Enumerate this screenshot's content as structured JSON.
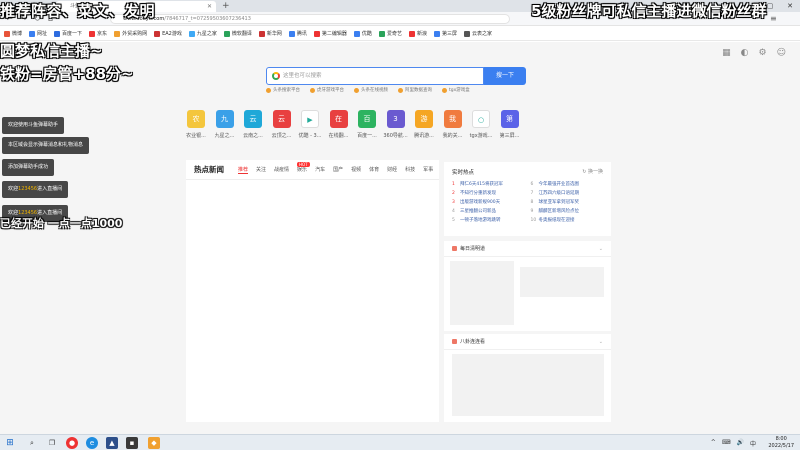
{
  "browser": {
    "tab_title": "斗鱼直播",
    "url_host": "www.douyu.com",
    "url_rest": "/7846717_t=0725950360723641​3",
    "window_controls": [
      "—",
      "▢",
      "✕"
    ],
    "new_tab": "+"
  },
  "bookmarks": [
    {
      "label": "微博",
      "color": "#e8543a"
    },
    {
      "label": "网址",
      "color": "#3b7ff0"
    },
    {
      "label": "百度一下",
      "color": "#2d6cdf"
    },
    {
      "label": "京东",
      "color": "#e33"
    },
    {
      "label": "外贸采购网",
      "color": "#f0a030"
    },
    {
      "label": "EA2游戏",
      "color": "#c33"
    },
    {
      "label": "九星之家",
      "color": "#3fa9f5"
    },
    {
      "label": "微软翻译",
      "color": "#2aa35a"
    },
    {
      "label": "新华网",
      "color": "#c33"
    },
    {
      "label": "腾讯",
      "color": "#3b7ff0"
    },
    {
      "label": "第二编辑器",
      "color": "#e33"
    },
    {
      "label": "优酷",
      "color": "#3b7ff0"
    },
    {
      "label": "爱奇艺",
      "color": "#2aa35a"
    },
    {
      "label": "新浪",
      "color": "#e33"
    },
    {
      "label": "第三屏",
      "color": "#3b7ff0"
    },
    {
      "label": "云表之家",
      "color": "#555"
    }
  ],
  "search": {
    "placeholder": "这里也可以搜索",
    "button_label": "搜一下"
  },
  "quick_links": [
    "头条搜索平台",
    "虎牙游戏平台",
    "头条在线视频",
    "阿里数据查询",
    "tgx游戏盒"
  ],
  "apps": [
    {
      "label": "农业银...",
      "glyph": "农",
      "color": "#f4c63d"
    },
    {
      "label": "九星之...",
      "glyph": "九",
      "color": "#3aa0e8"
    },
    {
      "label": "云南之...",
      "glyph": "云",
      "color": "#1fa8d8"
    },
    {
      "label": "云顶之...",
      "glyph": "云",
      "color": "#e84040"
    },
    {
      "label": "优酷 - 3...",
      "glyph": "▶",
      "color": "#ffffff"
    },
    {
      "label": "在线翻...",
      "glyph": "在",
      "color": "#e84040"
    },
    {
      "label": "百度一...",
      "glyph": "百",
      "color": "#2db360"
    },
    {
      "label": "360导航...",
      "glyph": "3",
      "color": "#6a5ad0"
    },
    {
      "label": "腾讯游...",
      "glyph": "游",
      "color": "#f5a623"
    },
    {
      "label": "我的关...",
      "glyph": "我",
      "color": "#f07b3f"
    },
    {
      "label": "tgx游戏...",
      "glyph": "○",
      "color": "#ffffff"
    },
    {
      "label": "第三屏...",
      "glyph": "第",
      "color": "#5b63e8"
    }
  ],
  "news": {
    "title": "热点新闻",
    "tabs": [
      "推荐",
      "关注",
      "战疫情",
      "娱乐",
      "汽车",
      "国产",
      "视频",
      "体育",
      "财经",
      "科技",
      "军事"
    ],
    "hot_badge": "HOT"
  },
  "hot_search": {
    "title": "实时热点",
    "refresh": "换一换",
    "items": [
      {
        "num": "1",
        "text": "拜仁6天415将获冠军"
      },
      {
        "num": "6",
        "text": "今年最强开业首选图"
      },
      {
        "num": "2",
        "text": "不知行分重新发现"
      },
      {
        "num": "7",
        "text": "江苏四六级口语延期"
      },
      {
        "num": "3",
        "text": "出版游戏新规900天"
      },
      {
        "num": "8",
        "text": "球星亚军拿到冠军奖"
      },
      {
        "num": "4",
        "text": "三星推翻公司新品"
      },
      {
        "num": "9",
        "text": "麒麟区新增风险点位"
      },
      {
        "num": "5",
        "text": "一顿子落地游戏跳转"
      },
      {
        "num": "10",
        "text": "冬奥报纸现在迎接"
      }
    ]
  },
  "cards": {
    "daily": "每日清明道",
    "novel": "八卦连连看"
  },
  "overlay": {
    "top_left": "推荐阵容、菜文、发明",
    "top_right": "5级粉丝牌可私信主播进微信粉丝群",
    "line1": "圆梦私信主播~",
    "line2": "铁粉=房管+88分~",
    "bottom_left": "已经开始 一点一点1000"
  },
  "chat": [
    {
      "pre": "欢迎使用斗鱼弹幕助手",
      "hl": "",
      "post": ""
    },
    {
      "pre": "本区域会显示弹幕消息和礼物消息",
      "hl": "",
      "post": ""
    },
    {
      "pre": "添加弹幕助手成功",
      "hl": "",
      "post": ""
    },
    {
      "pre": "欢迎",
      "hl": "123456",
      "post": "进入直播间"
    },
    {
      "pre": "欢迎",
      "hl": "123456",
      "post": "进入直播间"
    }
  ],
  "taskbar": {
    "tray": [
      "^",
      "⌨",
      "🔊",
      "中"
    ],
    "time": "8:00",
    "date": "2022/5/17"
  }
}
